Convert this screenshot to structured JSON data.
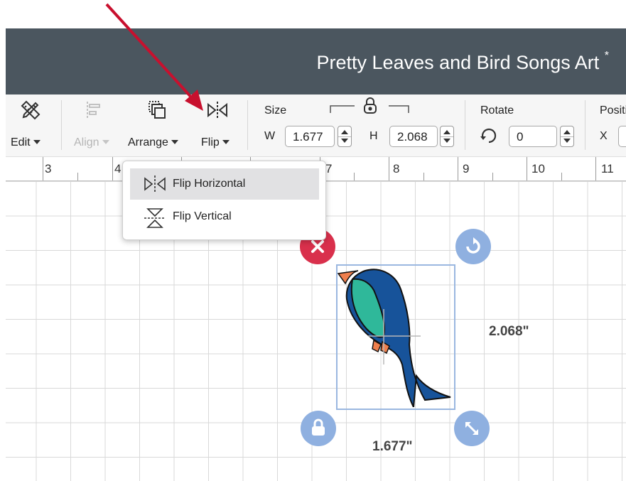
{
  "title_bar": {
    "project_name": "Pretty Leaves and Bird Songs Art",
    "unsaved_marker": "*",
    "background": "#4b565f"
  },
  "toolbar": {
    "edit": {
      "label": "Edit",
      "icon": "edit-pencil-ruler-icon"
    },
    "align": {
      "label": "Align",
      "icon": "align-icon",
      "disabled": true
    },
    "arrange": {
      "label": "Arrange",
      "icon": "arrange-icon"
    },
    "flip": {
      "label": "Flip",
      "icon": "flip-icon"
    },
    "size": {
      "label": "Size",
      "w_label": "W",
      "w_value": "1.677",
      "h_label": "H",
      "h_value": "2.068",
      "lock_icon": "lock-icon"
    },
    "rotate": {
      "label": "Rotate",
      "value": "0",
      "icon": "rotate-icon"
    },
    "position": {
      "label": "Positi",
      "x_label": "X"
    }
  },
  "ruler": {
    "numbers": [
      "3",
      "4",
      "7",
      "8",
      "9",
      "10",
      "11"
    ]
  },
  "flip_menu": {
    "items": [
      {
        "label": "Flip Horizontal",
        "icon": "flip-horizontal-icon",
        "highlighted": true
      },
      {
        "label": "Flip Vertical",
        "icon": "flip-vertical-icon",
        "highlighted": false
      }
    ]
  },
  "selection": {
    "width_label": "1.677\"",
    "height_label": "2.068\"",
    "handles": [
      "delete-handle",
      "rotate-handle",
      "lock-handle",
      "resize-handle"
    ]
  },
  "colors": {
    "accent_red": "#c8102e",
    "handle_blue": "#8fb0e0",
    "delete_red": "#d9304c",
    "bird_teal": "#2fb89a",
    "bird_blue": "#17539a"
  }
}
